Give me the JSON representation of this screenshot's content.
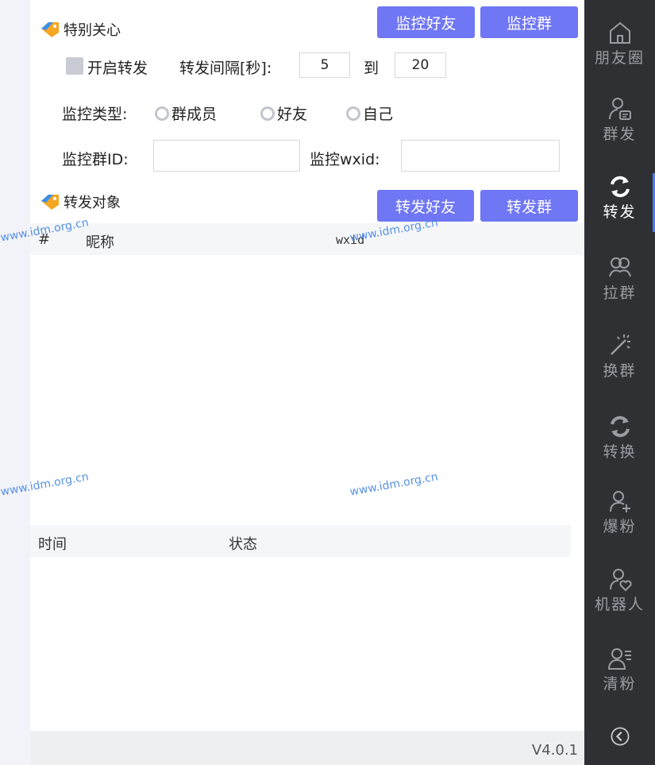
{
  "special_care": {
    "title": "特别关心",
    "monitor_friend_button": "监控好友",
    "monitor_group_button": "监控群",
    "enable_forward_label": "开启转发",
    "interval_label": "转发间隔[秒]:",
    "interval_from": "5",
    "interval_to_label": "到",
    "interval_to": "20",
    "monitor_type_label": "监控类型:",
    "radio_options": [
      "群成员",
      "好友",
      "自己"
    ],
    "monitor_group_id_label": "监控群ID:",
    "monitor_wxid_label": "监控wxid:"
  },
  "forward_target": {
    "title": "转发对象",
    "forward_friend_button": "转发好友",
    "forward_group_button": "转发群",
    "columns": [
      "#",
      "昵称",
      "wxid"
    ]
  },
  "log_table": {
    "columns": [
      "时间",
      "状态"
    ]
  },
  "footer": {
    "version": "V4.0.1"
  },
  "sidebar": {
    "items": [
      {
        "label": "朋友圈",
        "icon": "home-icon"
      },
      {
        "label": "群发",
        "icon": "user-message-icon"
      },
      {
        "label": "转发",
        "icon": "refresh-icon",
        "active": true
      },
      {
        "label": "拉群",
        "icon": "users-icon"
      },
      {
        "label": "换群",
        "icon": "sparkle-icon"
      },
      {
        "label": "转换",
        "icon": "refresh-icon"
      },
      {
        "label": "爆粉",
        "icon": "user-plus-icon"
      },
      {
        "label": "机器人",
        "icon": "user-heart-icon"
      },
      {
        "label": "清粉",
        "icon": "user-list-icon"
      }
    ],
    "back_icon": "chevron-left-circle-icon"
  },
  "watermarks": [
    "www.idm.org.cn",
    "www.idm.org.cn",
    "www.idm.org.cn",
    "www.idm.org.cn"
  ],
  "colors": {
    "button_bg": "#7077f4",
    "sidebar_bg": "#2e3034",
    "sidebar_active_indicator": "#4a7cf5",
    "watermark": "#3a7fe0"
  }
}
